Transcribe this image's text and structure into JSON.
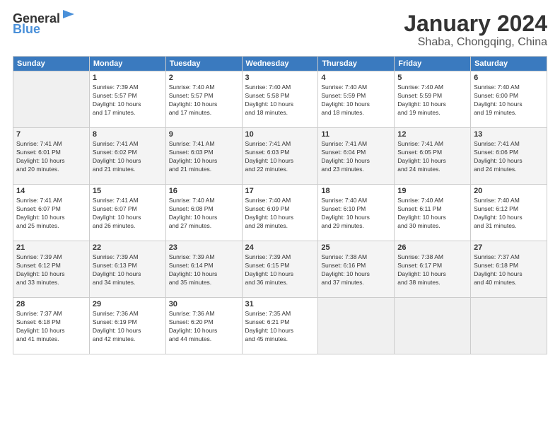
{
  "logo": {
    "general": "General",
    "blue": "Blue"
  },
  "header": {
    "title": "January 2024",
    "subtitle": "Shaba, Chongqing, China"
  },
  "columns": [
    "Sunday",
    "Monday",
    "Tuesday",
    "Wednesday",
    "Thursday",
    "Friday",
    "Saturday"
  ],
  "weeks": [
    [
      {
        "day": "",
        "info": ""
      },
      {
        "day": "1",
        "info": "Sunrise: 7:39 AM\nSunset: 5:57 PM\nDaylight: 10 hours\nand 17 minutes."
      },
      {
        "day": "2",
        "info": "Sunrise: 7:40 AM\nSunset: 5:57 PM\nDaylight: 10 hours\nand 17 minutes."
      },
      {
        "day": "3",
        "info": "Sunrise: 7:40 AM\nSunset: 5:58 PM\nDaylight: 10 hours\nand 18 minutes."
      },
      {
        "day": "4",
        "info": "Sunrise: 7:40 AM\nSunset: 5:59 PM\nDaylight: 10 hours\nand 18 minutes."
      },
      {
        "day": "5",
        "info": "Sunrise: 7:40 AM\nSunset: 5:59 PM\nDaylight: 10 hours\nand 19 minutes."
      },
      {
        "day": "6",
        "info": "Sunrise: 7:40 AM\nSunset: 6:00 PM\nDaylight: 10 hours\nand 19 minutes."
      }
    ],
    [
      {
        "day": "7",
        "info": "Sunrise: 7:41 AM\nSunset: 6:01 PM\nDaylight: 10 hours\nand 20 minutes."
      },
      {
        "day": "8",
        "info": "Sunrise: 7:41 AM\nSunset: 6:02 PM\nDaylight: 10 hours\nand 21 minutes."
      },
      {
        "day": "9",
        "info": "Sunrise: 7:41 AM\nSunset: 6:03 PM\nDaylight: 10 hours\nand 21 minutes."
      },
      {
        "day": "10",
        "info": "Sunrise: 7:41 AM\nSunset: 6:03 PM\nDaylight: 10 hours\nand 22 minutes."
      },
      {
        "day": "11",
        "info": "Sunrise: 7:41 AM\nSunset: 6:04 PM\nDaylight: 10 hours\nand 23 minutes."
      },
      {
        "day": "12",
        "info": "Sunrise: 7:41 AM\nSunset: 6:05 PM\nDaylight: 10 hours\nand 24 minutes."
      },
      {
        "day": "13",
        "info": "Sunrise: 7:41 AM\nSunset: 6:06 PM\nDaylight: 10 hours\nand 24 minutes."
      }
    ],
    [
      {
        "day": "14",
        "info": "Sunrise: 7:41 AM\nSunset: 6:07 PM\nDaylight: 10 hours\nand 25 minutes."
      },
      {
        "day": "15",
        "info": "Sunrise: 7:41 AM\nSunset: 6:07 PM\nDaylight: 10 hours\nand 26 minutes."
      },
      {
        "day": "16",
        "info": "Sunrise: 7:40 AM\nSunset: 6:08 PM\nDaylight: 10 hours\nand 27 minutes."
      },
      {
        "day": "17",
        "info": "Sunrise: 7:40 AM\nSunset: 6:09 PM\nDaylight: 10 hours\nand 28 minutes."
      },
      {
        "day": "18",
        "info": "Sunrise: 7:40 AM\nSunset: 6:10 PM\nDaylight: 10 hours\nand 29 minutes."
      },
      {
        "day": "19",
        "info": "Sunrise: 7:40 AM\nSunset: 6:11 PM\nDaylight: 10 hours\nand 30 minutes."
      },
      {
        "day": "20",
        "info": "Sunrise: 7:40 AM\nSunset: 6:12 PM\nDaylight: 10 hours\nand 31 minutes."
      }
    ],
    [
      {
        "day": "21",
        "info": "Sunrise: 7:39 AM\nSunset: 6:12 PM\nDaylight: 10 hours\nand 33 minutes."
      },
      {
        "day": "22",
        "info": "Sunrise: 7:39 AM\nSunset: 6:13 PM\nDaylight: 10 hours\nand 34 minutes."
      },
      {
        "day": "23",
        "info": "Sunrise: 7:39 AM\nSunset: 6:14 PM\nDaylight: 10 hours\nand 35 minutes."
      },
      {
        "day": "24",
        "info": "Sunrise: 7:39 AM\nSunset: 6:15 PM\nDaylight: 10 hours\nand 36 minutes."
      },
      {
        "day": "25",
        "info": "Sunrise: 7:38 AM\nSunset: 6:16 PM\nDaylight: 10 hours\nand 37 minutes."
      },
      {
        "day": "26",
        "info": "Sunrise: 7:38 AM\nSunset: 6:17 PM\nDaylight: 10 hours\nand 38 minutes."
      },
      {
        "day": "27",
        "info": "Sunrise: 7:37 AM\nSunset: 6:18 PM\nDaylight: 10 hours\nand 40 minutes."
      }
    ],
    [
      {
        "day": "28",
        "info": "Sunrise: 7:37 AM\nSunset: 6:18 PM\nDaylight: 10 hours\nand 41 minutes."
      },
      {
        "day": "29",
        "info": "Sunrise: 7:36 AM\nSunset: 6:19 PM\nDaylight: 10 hours\nand 42 minutes."
      },
      {
        "day": "30",
        "info": "Sunrise: 7:36 AM\nSunset: 6:20 PM\nDaylight: 10 hours\nand 44 minutes."
      },
      {
        "day": "31",
        "info": "Sunrise: 7:35 AM\nSunset: 6:21 PM\nDaylight: 10 hours\nand 45 minutes."
      },
      {
        "day": "",
        "info": ""
      },
      {
        "day": "",
        "info": ""
      },
      {
        "day": "",
        "info": ""
      }
    ]
  ]
}
